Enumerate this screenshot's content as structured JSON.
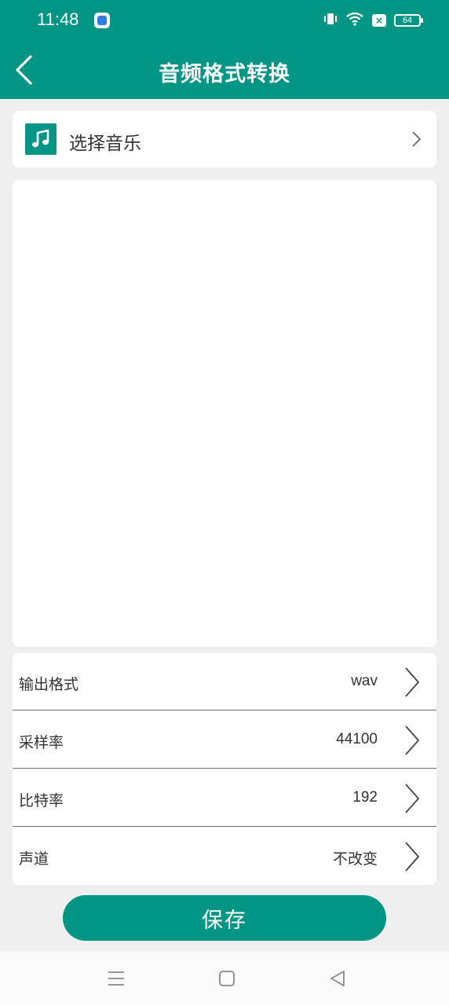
{
  "status_bar": {
    "time": "11:48",
    "battery_level": "64",
    "icons": [
      "app-notification-icon",
      "vibrate-icon",
      "wifi-icon",
      "no-sim-icon",
      "battery-icon"
    ]
  },
  "app_bar": {
    "title": "音频格式转换",
    "back_icon": "back-arrow-icon"
  },
  "select_music": {
    "label": "选择音乐",
    "icon": "music-note-icon"
  },
  "settings": [
    {
      "label": "输出格式",
      "value": "wav"
    },
    {
      "label": "采样率",
      "value": "44100"
    },
    {
      "label": "比特率",
      "value": "192"
    },
    {
      "label": "声道",
      "value": "不改变"
    }
  ],
  "save_button": {
    "label": "保存"
  },
  "nav_bar": {
    "buttons": [
      "menu-icon",
      "home-icon",
      "back-icon"
    ]
  },
  "colors": {
    "primary": "#009585",
    "background": "#efefef",
    "card": "#ffffff"
  }
}
